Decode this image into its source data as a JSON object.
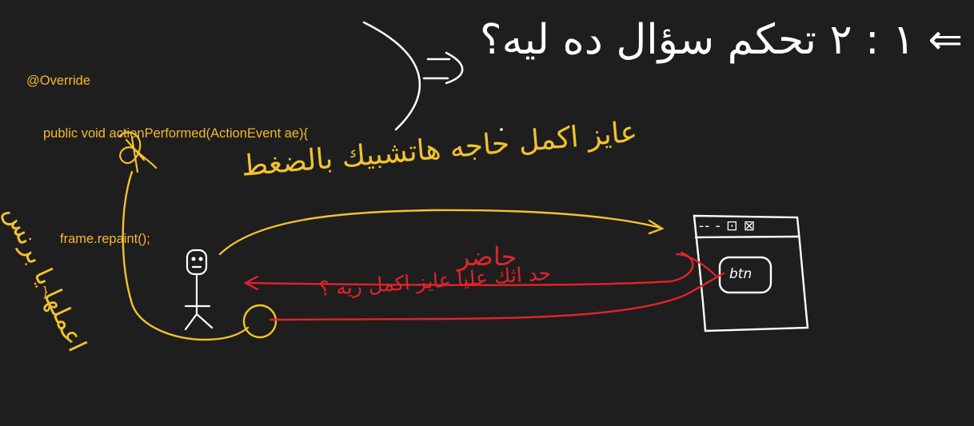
{
  "code": {
    "annotation": "@Override",
    "signature": "public void actionPerformed(ActionEvent ae){",
    "statement": "frame.repaint();",
    "closing": "}"
  },
  "handwriting": {
    "top_right_white": "١ : ٢ تحكم سؤال ده ليه؟ ⇐",
    "yellow_top": "عايز اكمل حاجه هاتشبيك بالضغط",
    "yellow_side": "اعملها يا برنس",
    "red_upper": "حاضر",
    "red_lower": "حد اثك عليا عايز اكمل ريه ؟"
  },
  "window": {
    "title_controls": "‐‐ - ⊡ ⊠",
    "button_label": "btn"
  },
  "colors": {
    "background": "#1e1e1e",
    "code": "#f5b82e",
    "yellow_ink": "#f2c230",
    "red_ink": "#e0242b",
    "white_ink": "#ffffff"
  }
}
